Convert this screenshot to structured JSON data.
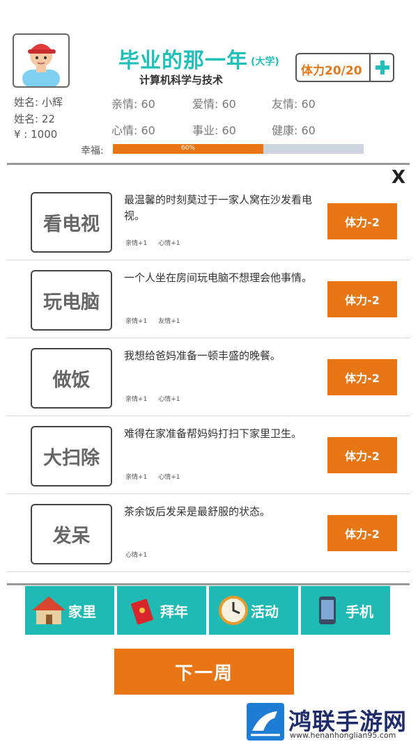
{
  "header": {
    "title": "毕业的那一年",
    "title_tag": "(大学)",
    "subtitle": "计算机科学与技术",
    "stamina": "体力20/20"
  },
  "profile": {
    "name": "姓名: 小辉",
    "age": "姓名: 22",
    "money": "¥ : 1000"
  },
  "stats": {
    "family": "亲情: 60",
    "love": "爱情: 60",
    "friendship": "友情: 60",
    "mood": "心情: 60",
    "career": "事业: 60",
    "health": "健康: 60"
  },
  "happiness": {
    "label": "幸福:",
    "value_text": "60%",
    "value": 0.6
  },
  "close_label": "X",
  "activities": [
    {
      "name": "看电视",
      "desc": "最温馨的时刻莫过于一家人窝在沙发看电视。",
      "effect1": "亲情+1",
      "effect2": "心情+1",
      "cost": "体力-2"
    },
    {
      "name": "玩电脑",
      "desc": "一个人坐在房间玩电脑不想理会他事情。",
      "effect1": "亲情+1",
      "effect2": "友情+1",
      "cost": "体力-2"
    },
    {
      "name": "做饭",
      "desc": "我想给爸妈准备一顿丰盛的晚餐。",
      "effect1": "亲情+1",
      "effect2": "心情+1",
      "cost": "体力-2"
    },
    {
      "name": "大扫除",
      "desc": "难得在家准备帮妈妈打扫下家里卫生。",
      "effect1": "亲情+1",
      "effect2": "心情+1",
      "cost": "体力-2"
    },
    {
      "name": "发呆",
      "desc": "茶余饭后发呆是最舒服的状态。",
      "effect1": "心情+1",
      "effect2": "",
      "cost": "体力-2"
    }
  ],
  "nav": {
    "home": "家里",
    "new_year": "拜年",
    "activity": "活动",
    "phone": "手机"
  },
  "next_week": "下一周",
  "watermark": {
    "name": "鸿联手游网",
    "url": "www.henanhonglian95.com"
  }
}
